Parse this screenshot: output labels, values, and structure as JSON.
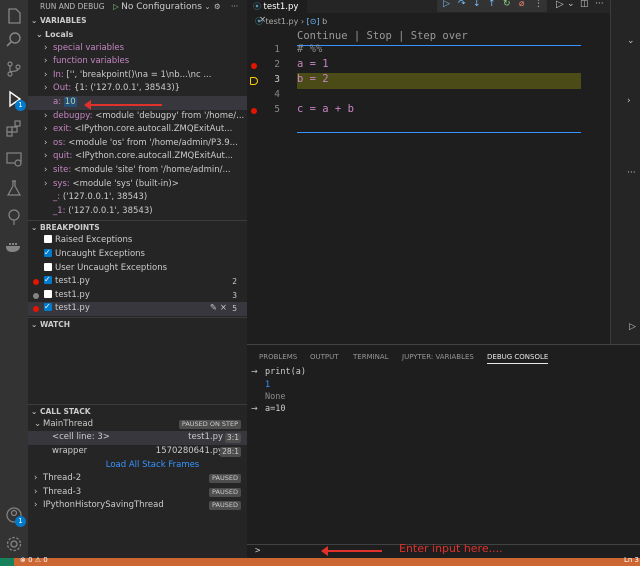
{
  "header": {
    "title": "RUN AND DEBUG",
    "config": "No Configurations"
  },
  "variables": {
    "title": "VARIABLES",
    "locals_label": "Locals",
    "rows": [
      {
        "name": "special variables",
        "value": ""
      },
      {
        "name": "function variables",
        "value": ""
      },
      {
        "name": "In:",
        "value": "['', 'breakpoint()\\na = 1\\nb...\\nc ..."
      },
      {
        "name": "Out:",
        "value": "{1: ('127.0.0.1', 38543)}"
      },
      {
        "name": "a:",
        "value": "10"
      },
      {
        "name": "debugpy:",
        "value": "<module 'debugpy' from '/home/..."
      },
      {
        "name": "exit:",
        "value": "<IPython.core.autocall.ZMQExitAut..."
      },
      {
        "name": "os:",
        "value": "<module 'os' from '/home/admin/P3.9..."
      },
      {
        "name": "quit:",
        "value": "<IPython.core.autocall.ZMQExitAut..."
      },
      {
        "name": "site:",
        "value": "<module 'site' from '/home/admin/..."
      },
      {
        "name": "sys:",
        "value": "<module 'sys' (built-in)>"
      },
      {
        "name": "_:",
        "value": "('127.0.0.1', 38543)"
      },
      {
        "name": "_1:",
        "value": "('127.0.0.1', 38543)"
      }
    ]
  },
  "breakpoints": {
    "title": "BREAKPOINTS",
    "items": [
      {
        "label": "Raised Exceptions",
        "checked": false,
        "dot": "",
        "count": ""
      },
      {
        "label": "Uncaught Exceptions",
        "checked": true,
        "dot": "",
        "count": ""
      },
      {
        "label": "User Uncaught Exceptions",
        "checked": false,
        "dot": "",
        "count": ""
      },
      {
        "label": "test1.py",
        "checked": true,
        "dot": "red",
        "count": "2"
      },
      {
        "label": "test1.py",
        "checked": false,
        "dot": "grey",
        "count": "3"
      },
      {
        "label": "test1.py",
        "checked": true,
        "dot": "red",
        "count": "5"
      }
    ]
  },
  "watch": {
    "title": "WATCH"
  },
  "call_stack": {
    "title": "CALL STACK",
    "main_thread": "MainThread",
    "main_status": "PAUSED ON STEP",
    "frames": [
      {
        "name": "<cell line: 3>",
        "file": "test1.py",
        "pos": "3:1"
      },
      {
        "name": "wrapper",
        "file": "1570280641.py",
        "pos": "28:1"
      }
    ],
    "load_all": "Load All Stack Frames",
    "threads": [
      {
        "name": "Thread-2",
        "status": "PAUSED"
      },
      {
        "name": "Thread-3",
        "status": "PAUSED"
      },
      {
        "name": "IPythonHistorySavingThread",
        "status": "PAUSED"
      }
    ]
  },
  "editor": {
    "tab": "test1.py",
    "breadcrumb_file": "test1.py",
    "breadcrumb_symbol": "b",
    "codelens": "Continue | Stop | Step over",
    "lines": [
      {
        "num": "1",
        "text": "# %%"
      },
      {
        "num": "2",
        "text": "a = 1"
      },
      {
        "num": "3",
        "text": "b = 2"
      },
      {
        "num": "4",
        "text": ""
      },
      {
        "num": "5",
        "text": "c = a + b"
      }
    ]
  },
  "panel": {
    "tabs": [
      "PROBLEMS",
      "OUTPUT",
      "TERMINAL",
      "JUPYTER: VARIABLES",
      "DEBUG CONSOLE"
    ],
    "console": [
      {
        "prefix": "→",
        "text": "print(a)",
        "color": "#cccccc"
      },
      {
        "prefix": "",
        "text": "1",
        "color": "#3794ff"
      },
      {
        "prefix": "",
        "text": "None",
        "color": "#8c8c8c"
      },
      {
        "prefix": "→",
        "text": "a=10",
        "color": "#cccccc"
      }
    ],
    "prompt": ">"
  },
  "annotation": "Enter input here....",
  "status": {
    "left": "⊗ 0 ⚠ 0",
    "right": "Ln 3"
  },
  "colors": {
    "accent": "#007acc",
    "statusbar": "#cc6633",
    "annotation": "#e0312a"
  }
}
